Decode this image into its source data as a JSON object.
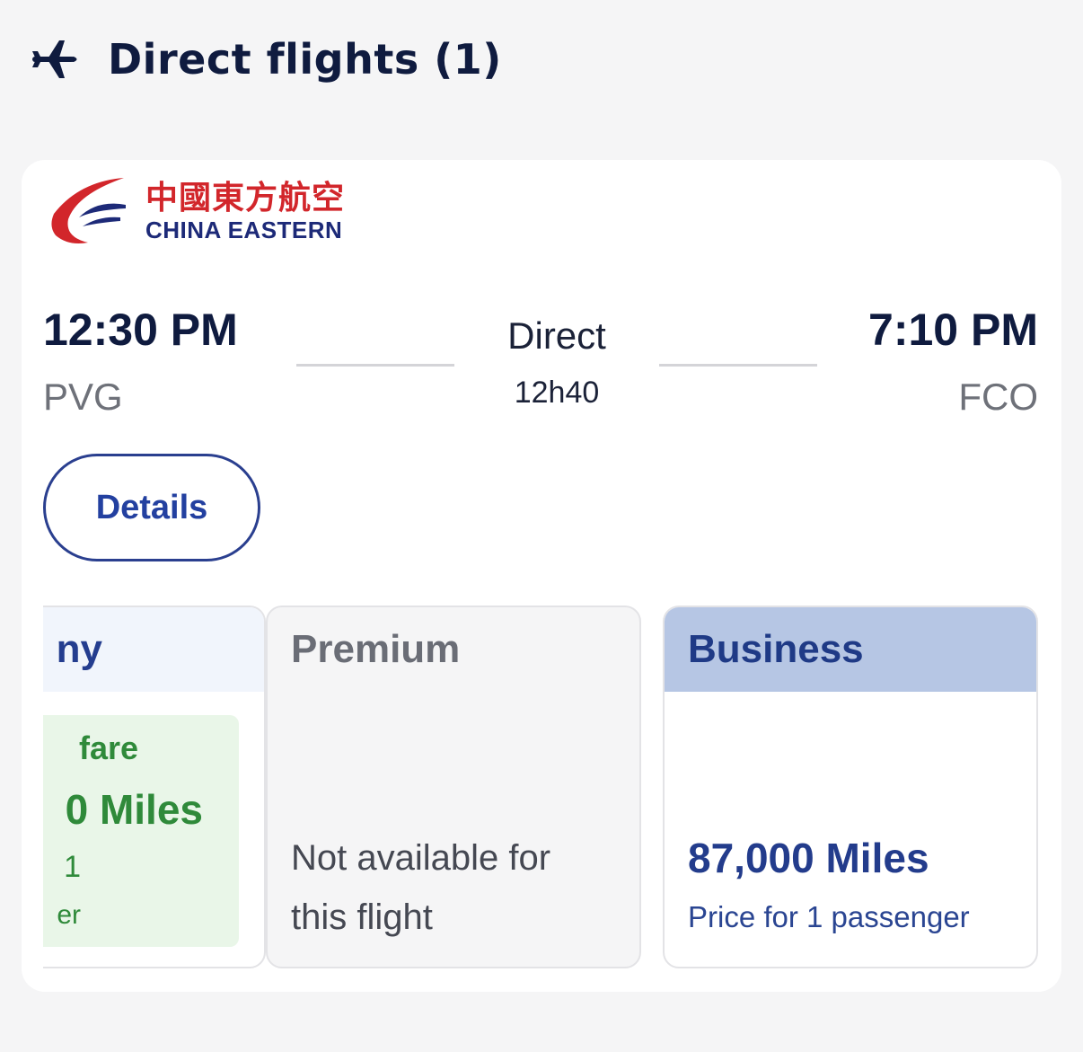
{
  "header": {
    "icon": "airplane-icon",
    "title": "Direct flights (1)"
  },
  "flight": {
    "airline": {
      "name_cn": "中國東方航空",
      "name_en": "CHINA EASTERN",
      "colors": {
        "red": "#d2262b",
        "navy": "#1d2a78"
      }
    },
    "departure": {
      "time": "12:30 PM",
      "airport": "PVG"
    },
    "arrival": {
      "time": "7:10 PM",
      "airport": "FCO"
    },
    "stops": "Direct",
    "duration": "12h40",
    "details_label": "Details"
  },
  "fares": [
    {
      "cabin": "ny",
      "fare_name": "fare",
      "price": "0 Miles",
      "note_line1": "1",
      "note_line2": "er",
      "accent": "#2f8a3a"
    },
    {
      "cabin": "Premium",
      "availability": "Not available for this flight"
    },
    {
      "cabin": "Business",
      "price": "87,000 Miles",
      "note": "Price for 1 passenger",
      "accent": "#b6c6e4"
    }
  ]
}
